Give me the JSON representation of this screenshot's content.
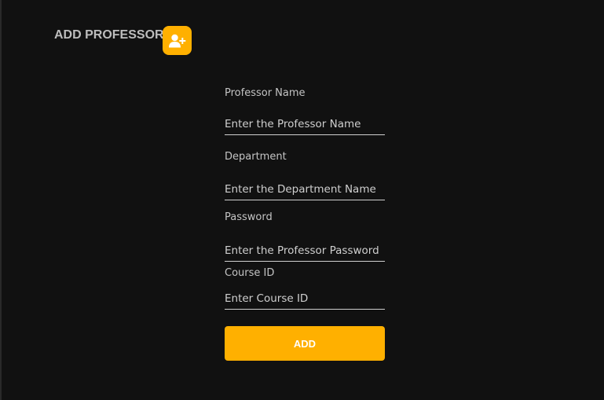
{
  "header": {
    "title": "ADD PROFESSOR",
    "icon": "user-plus-icon",
    "accent_color": "#ffb000"
  },
  "form": {
    "fields": [
      {
        "label": "Professor Name",
        "value": "",
        "placeholder": "Enter the Professor Name"
      },
      {
        "label": "Department",
        "value": "",
        "placeholder": "Enter the Department Name"
      },
      {
        "label": "Password",
        "value": "",
        "placeholder": "Enter the Professor Password"
      },
      {
        "label": "Course ID",
        "value": "",
        "placeholder": "Enter Course ID"
      }
    ],
    "submit_label": "ADD"
  },
  "colors": {
    "background": "#111111",
    "accent": "#ffb000",
    "text": "#c4c4c4"
  }
}
